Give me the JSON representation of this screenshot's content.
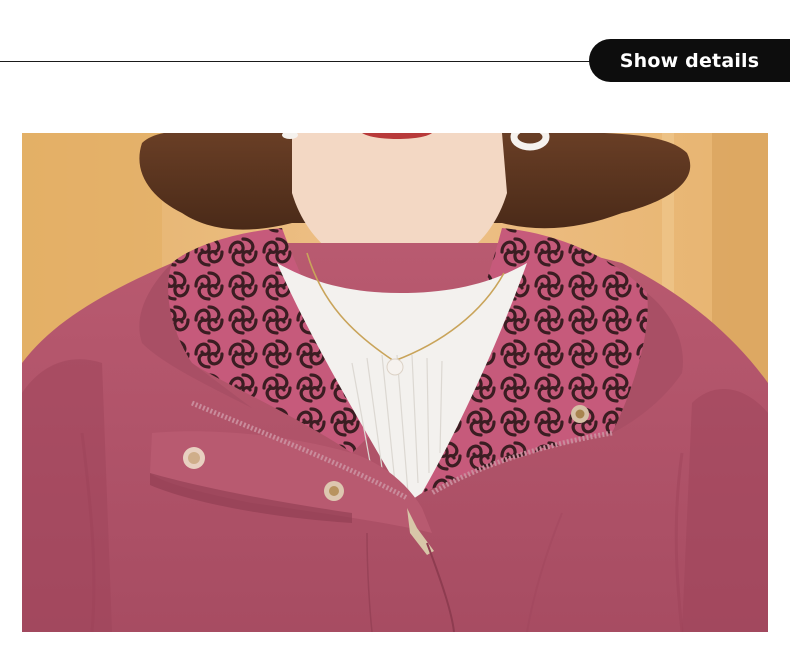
{
  "header": {
    "details_label": "Show details"
  },
  "photo": {
    "subject": "product-photo",
    "colors": {
      "coat": "#b05468",
      "coat_shadow": "#8e3c50",
      "lining_base": "#c45878",
      "lining_pattern": "#3a1e22",
      "sweater": "#f3f1ee",
      "hair": "#5a3420",
      "background_warm": "#e8b770",
      "skin": "#f3d8c4",
      "pearl": "#f4f0ec"
    }
  }
}
